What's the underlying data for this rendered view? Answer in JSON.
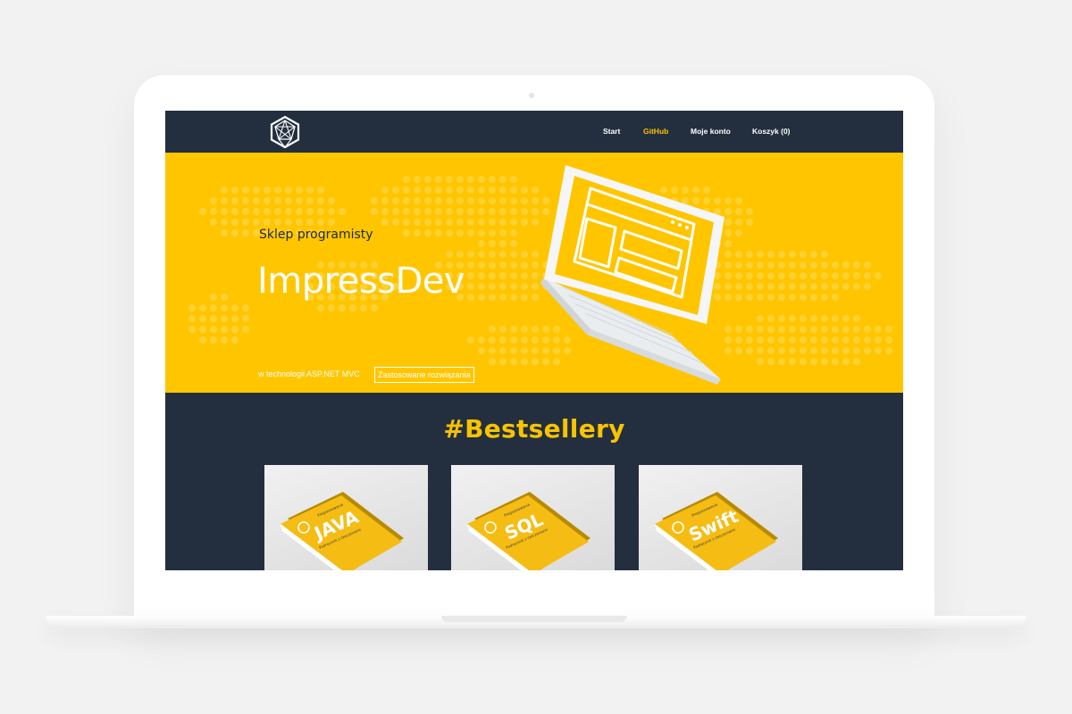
{
  "nav": {
    "items": [
      {
        "label": "Start",
        "active": false
      },
      {
        "label": "GitHub",
        "active": true
      },
      {
        "label": "Moje konto",
        "active": false
      },
      {
        "label": "Koszyk (0)",
        "active": false
      }
    ]
  },
  "hero": {
    "subtitle": "Sklep programisty",
    "title": "ImpressDev",
    "tech_text": "w technologii ASP.NET MVC",
    "button_label": "Zastosowane rozwiązania"
  },
  "bestsellers": {
    "title": "#Bestsellery",
    "books": [
      {
        "title": "JAVA",
        "small": "Programowanie",
        "tagline": "Podręcznik z ćwiczeniami"
      },
      {
        "title": "SQL",
        "small": "Programowanie",
        "tagline": "Podręcznik z ćwiczeniami"
      },
      {
        "title": "Swift",
        "small": "Programowanie",
        "tagline": "Podręcznik z ćwiczeniami"
      }
    ]
  },
  "colors": {
    "navy": "#232f3f",
    "yellow": "#ffc600",
    "accent": "#f8c300",
    "white": "#ffffff"
  },
  "icons": {
    "logo": "geodesic-hexagon-logo"
  }
}
